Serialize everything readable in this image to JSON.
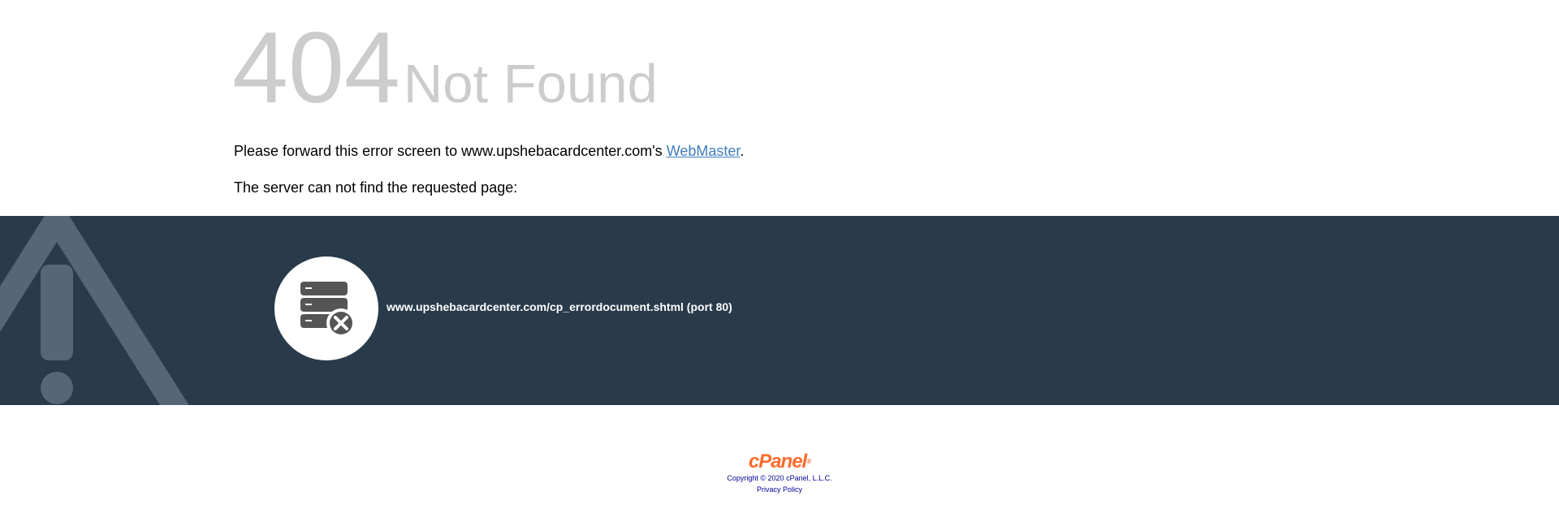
{
  "error": {
    "code": "404",
    "label": "Not Found"
  },
  "messages": {
    "forward_prefix": "Please forward this error screen to www.upshebacardcenter.com's ",
    "webmaster_link": "WebMaster",
    "forward_suffix": ".",
    "not_found": "The server can not find the requested page:"
  },
  "banner": {
    "warning_icon": "warning-triangle-icon",
    "server_icon": "server-error-icon",
    "url": "www.upshebacardcenter.com/cp_errordocument.shtml (port 80)"
  },
  "footer": {
    "brand": "cPanel",
    "brand_mark": "®",
    "copyright": "Copyright © 2020 cPanel, L.L.C.",
    "privacy": "Privacy Policy"
  },
  "colors": {
    "banner_bg": "#293a4a",
    "error_text": "#cccccc",
    "link": "#3f7fbf",
    "brand": "#ff6c2c",
    "footer_text": "#000099"
  }
}
